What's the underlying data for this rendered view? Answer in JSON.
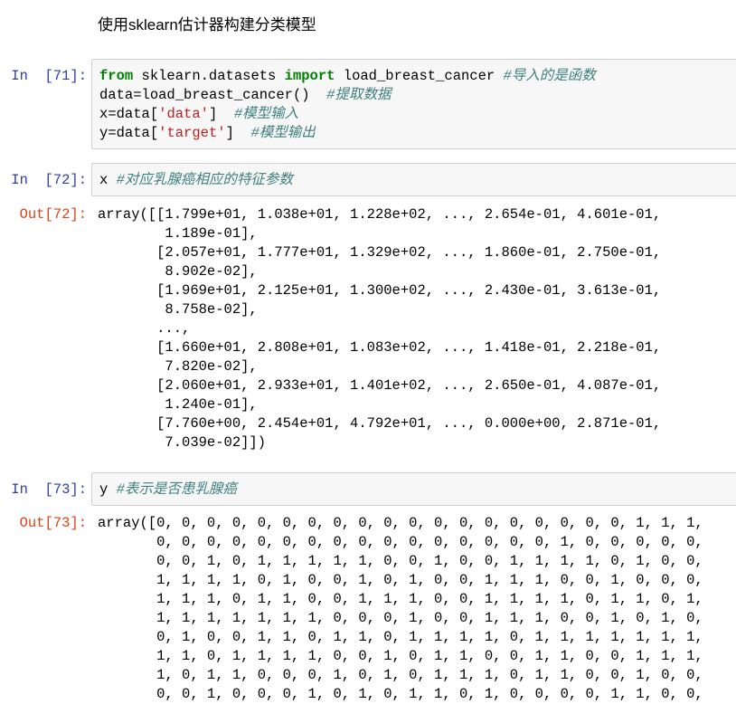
{
  "markdown_cell": {
    "text": "使用sklearn估计器构建分类模型"
  },
  "cells": [
    {
      "in_prompt": "In  [71]:",
      "code_lines": [
        [
          {
            "t": "from",
            "c": "kw"
          },
          {
            "t": " sklearn.datasets ",
            "c": ""
          },
          {
            "t": "import",
            "c": "kw"
          },
          {
            "t": " load_breast_cancer ",
            "c": ""
          },
          {
            "t": "#导入的是函数",
            "c": "cm"
          }
        ],
        [
          {
            "t": "data",
            "c": ""
          },
          {
            "t": "=",
            "c": ""
          },
          {
            "t": "load_breast_cancer()  ",
            "c": ""
          },
          {
            "t": "#提取数据",
            "c": "cm"
          }
        ],
        [
          {
            "t": "x",
            "c": ""
          },
          {
            "t": "=",
            "c": ""
          },
          {
            "t": "data[",
            "c": ""
          },
          {
            "t": "'data'",
            "c": "st"
          },
          {
            "t": "]  ",
            "c": ""
          },
          {
            "t": "#模型输入",
            "c": "cm"
          }
        ],
        [
          {
            "t": "y",
            "c": ""
          },
          {
            "t": "=",
            "c": ""
          },
          {
            "t": "data[",
            "c": ""
          },
          {
            "t": "'target'",
            "c": "st"
          },
          {
            "t": "]  ",
            "c": ""
          },
          {
            "t": "#模型输出",
            "c": "cm"
          }
        ]
      ]
    },
    {
      "in_prompt": "In  [72]:",
      "code_lines": [
        [
          {
            "t": "x ",
            "c": ""
          },
          {
            "t": "#对应乳腺癌相应的特征参数",
            "c": "cm"
          }
        ]
      ],
      "out_prompt": "Out[72]:",
      "output_lines": [
        "array([[1.799e+01, 1.038e+01, 1.228e+02, ..., 2.654e-01, 4.601e-01,",
        "        1.189e-01],",
        "       [2.057e+01, 1.777e+01, 1.329e+02, ..., 1.860e-01, 2.750e-01,",
        "        8.902e-02],",
        "       [1.969e+01, 2.125e+01, 1.300e+02, ..., 2.430e-01, 3.613e-01,",
        "        8.758e-02],",
        "       ...,",
        "       [1.660e+01, 2.808e+01, 1.083e+02, ..., 1.418e-01, 2.218e-01,",
        "        7.820e-02],",
        "       [2.060e+01, 2.933e+01, 1.401e+02, ..., 2.650e-01, 4.087e-01,",
        "        1.240e-01],",
        "       [7.760e+00, 2.454e+01, 4.792e+01, ..., 0.000e+00, 2.871e-01,",
        "        7.039e-02]])"
      ]
    },
    {
      "in_prompt": "In  [73]:",
      "code_lines": [
        [
          {
            "t": "y ",
            "c": ""
          },
          {
            "t": "#表示是否患乳腺癌",
            "c": "cm"
          }
        ]
      ],
      "out_prompt": "Out[73]:",
      "output_lines": [
        "array([0, 0, 0, 0, 0, 0, 0, 0, 0, 0, 0, 0, 0, 0, 0, 0, 0, 0, 0, 1, 1, 1,",
        "       0, 0, 0, 0, 0, 0, 0, 0, 0, 0, 0, 0, 0, 0, 0, 0, 1, 0, 0, 0, 0, 0,",
        "       0, 0, 1, 0, 1, 1, 1, 1, 1, 0, 0, 1, 0, 0, 1, 1, 1, 1, 0, 1, 0, 0,",
        "       1, 1, 1, 1, 0, 1, 0, 0, 1, 0, 1, 0, 0, 1, 1, 1, 0, 0, 1, 0, 0, 0,",
        "       1, 1, 1, 0, 1, 1, 0, 0, 1, 1, 1, 0, 0, 1, 1, 1, 1, 0, 1, 1, 0, 1,",
        "       1, 1, 1, 1, 1, 1, 1, 0, 0, 0, 1, 0, 0, 1, 1, 1, 0, 0, 1, 0, 1, 0,",
        "       0, 1, 0, 0, 1, 1, 0, 1, 1, 0, 1, 1, 1, 1, 0, 1, 1, 1, 1, 1, 1, 1,",
        "       1, 1, 0, 1, 1, 1, 1, 0, 0, 1, 0, 1, 1, 0, 0, 1, 1, 0, 0, 1, 1, 1,",
        "       1, 0, 1, 1, 0, 0, 0, 1, 0, 1, 0, 1, 1, 1, 0, 1, 1, 0, 0, 1, 0, 0,",
        "       0, 0, 1, 0, 0, 0, 1, 0, 1, 0, 1, 1, 0, 1, 0, 0, 0, 0, 1, 1, 0, 0,"
      ]
    }
  ]
}
